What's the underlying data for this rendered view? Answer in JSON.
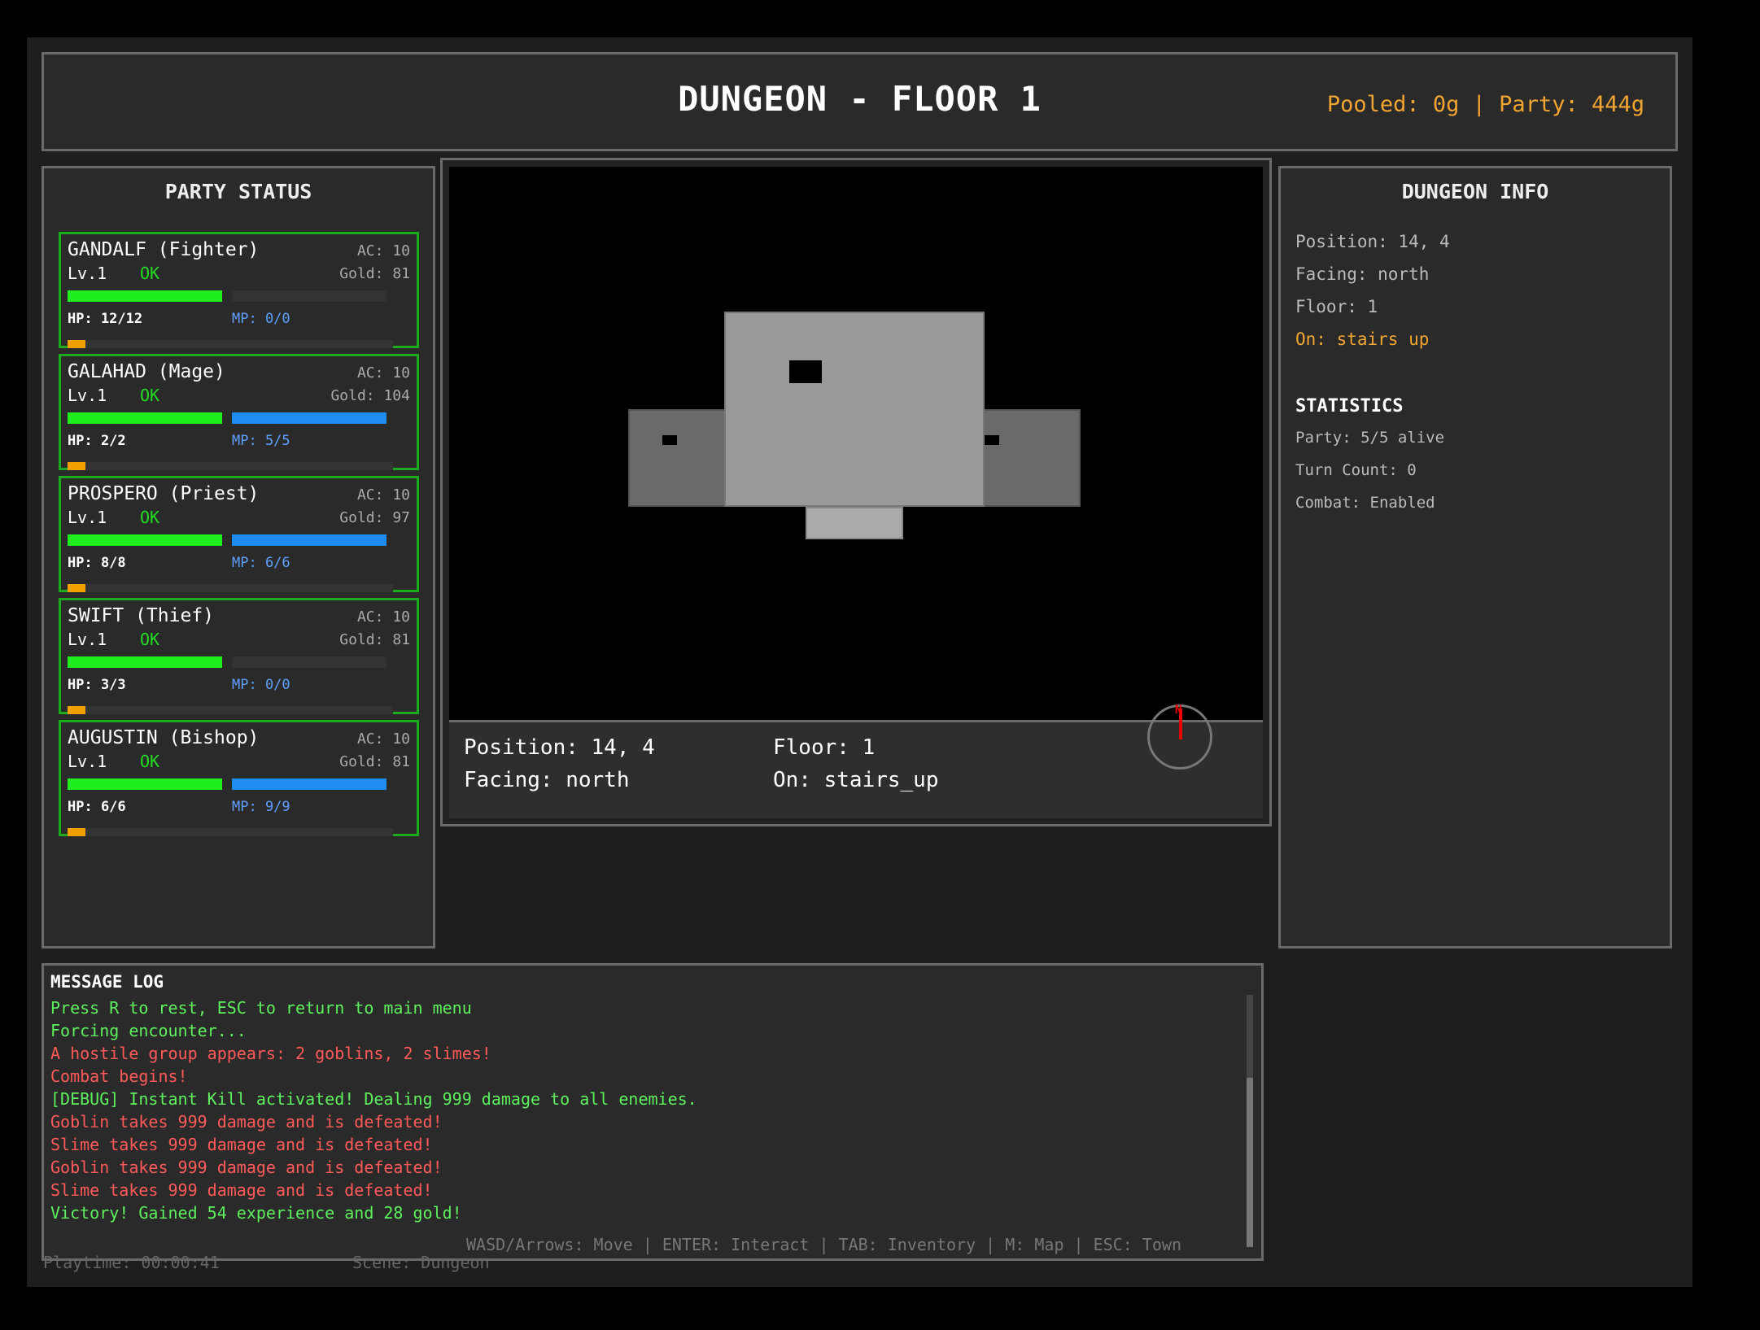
{
  "header": {
    "title": "DUNGEON - FLOOR 1",
    "gold": "Pooled: 0g | Party: 444g"
  },
  "party": {
    "title": "PARTY STATUS",
    "members": [
      {
        "name": "GANDALF (Fighter)",
        "ac": "AC: 10",
        "level": "Lv.1",
        "status": "OK",
        "gold": "Gold: 81",
        "hp": "HP: 12/12",
        "mp": "MP: 0/0",
        "hp_frac": 1.0,
        "mp_frac": 0.0
      },
      {
        "name": "GALAHAD (Mage)",
        "ac": "AC: 10",
        "level": "Lv.1",
        "status": "OK",
        "gold": "Gold: 104",
        "hp": "HP: 2/2",
        "mp": "MP: 5/5",
        "hp_frac": 1.0,
        "mp_frac": 1.0
      },
      {
        "name": "PROSPERO (Priest)",
        "ac": "AC: 10",
        "level": "Lv.1",
        "status": "OK",
        "gold": "Gold: 97",
        "hp": "HP: 8/8",
        "mp": "MP: 6/6",
        "hp_frac": 1.0,
        "mp_frac": 1.0
      },
      {
        "name": "SWIFT (Thief)",
        "ac": "AC: 10",
        "level": "Lv.1",
        "status": "OK",
        "gold": "Gold: 81",
        "hp": "HP: 3/3",
        "mp": "MP: 0/0",
        "hp_frac": 1.0,
        "mp_frac": 0.0
      },
      {
        "name": "AUGUSTIN (Bishop)",
        "ac": "AC: 10",
        "level": "Lv.1",
        "status": "OK",
        "gold": "Gold: 81",
        "hp": "HP: 6/6",
        "mp": "MP: 9/9",
        "hp_frac": 1.0,
        "mp_frac": 1.0
      }
    ]
  },
  "view": {
    "position": "Position: 14, 4",
    "facing": "Facing: north",
    "floor": "Floor: 1",
    "on": "On: stairs_up",
    "compass_label": "N"
  },
  "dungeon_info": {
    "title": "DUNGEON INFO",
    "position": "Position: 14, 4",
    "facing": "Facing: north",
    "floor": "Floor: 1",
    "on": "On: stairs up",
    "stats_title": "STATISTICS",
    "party_alive": "Party: 5/5 alive",
    "turn_count": "Turn Count: 0",
    "combat": "Combat: Enabled"
  },
  "log": {
    "title": "MESSAGE LOG",
    "messages": [
      {
        "text": "Press R to rest, ESC to return to main menu",
        "color": "#5ef05e"
      },
      {
        "text": "Forcing encounter...",
        "color": "#5ef05e"
      },
      {
        "text": "A hostile group appears: 2 goblins, 2 slimes!",
        "color": "#ff5a5a"
      },
      {
        "text": "Combat begins!",
        "color": "#ff5a5a"
      },
      {
        "text": "[DEBUG] Instant Kill activated! Dealing 999 damage to all enemies.",
        "color": "#5ef05e"
      },
      {
        "text": "Goblin takes 999 damage and is defeated!",
        "color": "#ff5a5a"
      },
      {
        "text": "Slime takes 999 damage and is defeated!",
        "color": "#ff5a5a"
      },
      {
        "text": "Goblin takes 999 damage and is defeated!",
        "color": "#ff5a5a"
      },
      {
        "text": "Slime takes 999 damage and is defeated!",
        "color": "#ff5a5a"
      },
      {
        "text": "Victory! Gained 54 experience and 28 gold!",
        "color": "#5ef05e"
      }
    ]
  },
  "controls": "WASD/Arrows: Move | ENTER: Interact | TAB: Inventory | M: Map | ESC: Town",
  "footer": {
    "playtime": "Playtime: 00:00:41",
    "scene": "Scene: Dungeon"
  }
}
